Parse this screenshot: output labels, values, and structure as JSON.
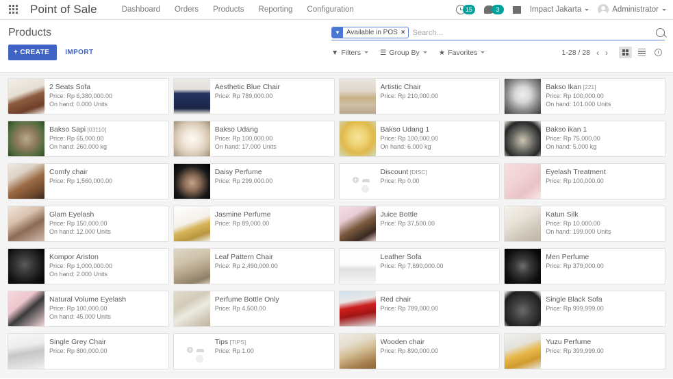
{
  "navbar": {
    "apps_icon": "apps-grid-icon",
    "brand": "Point of Sale",
    "menu": [
      {
        "label": "Dashboard"
      },
      {
        "label": "Orders"
      },
      {
        "label": "Products"
      },
      {
        "label": "Reporting"
      },
      {
        "label": "Configuration"
      }
    ],
    "activity_icon": "clock-icon",
    "activity_count": "15",
    "messages_icon": "chat-bubble-icon",
    "messages_count": "3",
    "gift_icon": "gift-icon",
    "company": "Impact Jakarta",
    "user": "Administrator",
    "badge_color": "#00a09d"
  },
  "control_panel": {
    "title": "Products",
    "create_label": "+ CREATE",
    "import_label": "IMPORT",
    "accent_color": "#3f64c4",
    "search": {
      "facet_icon": "filter-funnel-icon",
      "facet_label": "Available in POS",
      "facet_remove": "×",
      "placeholder": "Search...",
      "value": "",
      "search_icon": "search-icon"
    },
    "tools": [
      {
        "icon": "filter-icon",
        "label": "Filters"
      },
      {
        "icon": "group-by-icon",
        "label": "Group By"
      },
      {
        "icon": "star-icon",
        "label": "Favorites"
      }
    ],
    "pager": {
      "range": "1-28 / 28",
      "prev_icon": "chevron-left-icon",
      "next_icon": "chevron-right-icon"
    },
    "views": [
      {
        "name": "kanban-view",
        "icon": "kanban-icon",
        "active": true
      },
      {
        "name": "list-view",
        "icon": "list-icon",
        "active": false
      },
      {
        "name": "activity-view",
        "icon": "clock-icon",
        "active": false
      }
    ]
  },
  "products": [
    {
      "name": "2 Seats Sofa",
      "code": "",
      "price": "Price: Rp 6,380,000.00",
      "onhand": "On hand: 0.000 Units",
      "img": "sofa-brown",
      "placeholder": false
    },
    {
      "name": "Aesthetic Blue Chair",
      "code": "",
      "price": "Price: Rp 789,000.00",
      "onhand": "",
      "img": "chair-blue",
      "placeholder": false
    },
    {
      "name": "Artistic Chair",
      "code": "",
      "price": "Price: Rp 210,000.00",
      "onhand": "",
      "img": "chair-wood",
      "placeholder": false
    },
    {
      "name": "Bakso Ikan",
      "code": "[221]",
      "price": "Price: Rp 100,000.00",
      "onhand": "On hand: 101.000 Units",
      "img": "bakso-ikan",
      "placeholder": false
    },
    {
      "name": "Bakso Sapi",
      "code": "[03110]",
      "price": "Price: Rp 65,000.00",
      "onhand": "On hand: 260.000 kg",
      "img": "bakso-sapi",
      "placeholder": false
    },
    {
      "name": "Bakso Udang",
      "code": "",
      "price": "Price: Rp 100,000.00",
      "onhand": "On hand: 17.000 Units",
      "img": "bakso-udang",
      "placeholder": false
    },
    {
      "name": "Bakso Udang 1",
      "code": "",
      "price": "Price: Rp 100,000.00",
      "onhand": "On hand: 6.000 kg",
      "img": "bakso-udang-1",
      "placeholder": false
    },
    {
      "name": "Bakso ikan 1",
      "code": "",
      "price": "Price: Rp 75,000.00",
      "onhand": "On hand: 5.000 kg",
      "img": "bakso-ikan-1",
      "placeholder": false
    },
    {
      "name": "Comfy chair",
      "code": "",
      "price": "Price: Rp 1,560,000.00",
      "onhand": "",
      "img": "comfy-chair",
      "placeholder": false
    },
    {
      "name": "Daisy Perfume",
      "code": "",
      "price": "Price: Rp 299,000.00",
      "onhand": "",
      "img": "daisy-perfume",
      "placeholder": false
    },
    {
      "name": "Discount",
      "code": "[DISC]",
      "price": "Price: Rp 0.00",
      "onhand": "",
      "img": "",
      "placeholder": true
    },
    {
      "name": "Eyelash Treatment",
      "code": "",
      "price": "Price: Rp 100,000.00",
      "onhand": "",
      "img": "eyelash-treatment",
      "placeholder": false
    },
    {
      "name": "Glam Eyelash",
      "code": "",
      "price": "Price: Rp 150,000.00",
      "onhand": "On hand: 12.000 Units",
      "img": "glam-eyelash",
      "placeholder": false
    },
    {
      "name": "Jasmine Perfume",
      "code": "",
      "price": "Price: Rp 89,000.00",
      "onhand": "",
      "img": "jasmine-perfume",
      "placeholder": false
    },
    {
      "name": "Juice Bottle",
      "code": "",
      "price": "Price: Rp 37,500.00",
      "onhand": "",
      "img": "juice-bottle",
      "placeholder": false
    },
    {
      "name": "Katun Silk",
      "code": "",
      "price": "Price: Rp 10,000.00",
      "onhand": "On hand: 199.000 Units",
      "img": "katun-silk",
      "placeholder": false
    },
    {
      "name": "Kompor Ariston",
      "code": "",
      "price": "Price: Rp 1,000,000.00",
      "onhand": "On hand: 2.000 Units",
      "img": "kompor-ariston",
      "placeholder": false
    },
    {
      "name": "Leaf Pattern Chair",
      "code": "",
      "price": "Price: Rp 2,490,000.00",
      "onhand": "",
      "img": "leaf-pattern-chair",
      "placeholder": false
    },
    {
      "name": "Leather Sofa",
      "code": "",
      "price": "Price: Rp 7,690,000.00",
      "onhand": "",
      "img": "leather-sofa",
      "placeholder": false
    },
    {
      "name": "Men Perfume",
      "code": "",
      "price": "Price: Rp 379,000.00",
      "onhand": "",
      "img": "men-perfume",
      "placeholder": false
    },
    {
      "name": "Natural Volume Eyelash",
      "code": "",
      "price": "Price: Rp 100,000.00",
      "onhand": "On hand: 45.000 Units",
      "img": "natural-volume-eyelash",
      "placeholder": false
    },
    {
      "name": "Perfume Bottle Only",
      "code": "",
      "price": "Price: Rp 4,500.00",
      "onhand": "",
      "img": "perfume-bottle-only",
      "placeholder": false
    },
    {
      "name": "Red chair",
      "code": "",
      "price": "Price: Rp 789,000.00",
      "onhand": "",
      "img": "red-chair",
      "placeholder": false
    },
    {
      "name": "Single Black Sofa",
      "code": "",
      "price": "Price: Rp 999,999.00",
      "onhand": "",
      "img": "single-black-sofa",
      "placeholder": false
    },
    {
      "name": "Single Grey Chair",
      "code": "",
      "price": "Price: Rp 800,000.00",
      "onhand": "",
      "img": "single-grey-chair",
      "placeholder": false
    },
    {
      "name": "Tips",
      "code": "[TIPS]",
      "price": "Price: Rp 1.00",
      "onhand": "",
      "img": "",
      "placeholder": true
    },
    {
      "name": "Wooden chair",
      "code": "",
      "price": "Price: Rp 890,000.00",
      "onhand": "",
      "img": "wooden-chair",
      "placeholder": false
    },
    {
      "name": "Yuzu Perfume",
      "code": "",
      "price": "Price: Rp 399,999.00",
      "onhand": "",
      "img": "yuzu-perfume",
      "placeholder": false
    }
  ],
  "product_image_colors": {
    "sofa-brown": "linear-gradient(160deg,#f2efe9 0%,#e6ded3 40%,#8d5b3f 55%,#6f402a 80%,#efe9e0 100%)",
    "chair-blue": "linear-gradient(180deg,#eceae6 0%,#e3e0da 30%,#24335e 42%,#1b2647 85%,#dedbd5 100%)",
    "chair-wood": "linear-gradient(180deg,#e9e6e0 0%,#ddd6c9 35%,#c9b189 55%,#cfc0a5 75%,#b8a68d 100%)",
    "bakso-ikan": "radial-gradient(circle at 50% 45%,#efefef 0%,#d6d6d6 30%,#8e8e8e 60%,#3c3c3c 100%)",
    "bakso-sapi": "radial-gradient(circle at 50% 50%,#b9a98d 0%,#8d7a5c 40%,#4e6b3c 75%,#2f4326 100%)",
    "bakso-udang": "radial-gradient(circle at 50% 50%,#fdfbf6 0%,#f0e6d8 35%,#d8c9b4 65%,#9e8f7b 100%)",
    "bakso-udang-1": "radial-gradient(circle at 50% 45%,#f6e39a 0%,#edd070 35%,#e0b94b 60%,#cfd9c0 100%)",
    "bakso-ikan-1": "radial-gradient(circle at 50% 55%,#cfc6b6 0%,#6a6a64 40%,#262626 72%,#e8e4dc 100%)",
    "comfy-chair": "linear-gradient(150deg,#efe9e2 0%,#ddd2c4 30%,#9c6a44 55%,#6f4a2e 80%,#3a2a1e 100%)",
    "daisy-perfume": "radial-gradient(circle at 50% 55%,#c8a48a 0%,#8a6b55 30%,#1a1a1a 65%,#000 100%)",
    "eyelash-treatment": "linear-gradient(140deg,#f6dede 0%,#f2d2d4 40%,#e9c2c6 70%,#f8e8e8 100%)",
    "glam-eyelash": "linear-gradient(150deg,#efe6dd 0%,#d8c0ad 35%,#8d6a54 60%,#cfbcae 100%)",
    "jasmine-perfume": "linear-gradient(160deg,#ffffff 0%,#f4f1ea 45%,#d8b55c 60%,#b89640 80%,#f2efe8 100%)",
    "juice-bottle": "linear-gradient(150deg,#f3dfe4 0%,#e9cdd6 30%,#7a5a3e 55%,#3a2a20 80%,#e6d2cf 100%)",
    "katun-silk": "linear-gradient(150deg,#f5f2ec 0%,#e7e1d6 40%,#cfc7ba 70%,#bdb4a6 100%)",
    "kompor-ariston": "radial-gradient(circle at 45% 45%,#5a5a5a 0%,#333 35%,#111 70%,#000 100%)",
    "leaf-pattern-chair": "linear-gradient(160deg,#ded6c6 0%,#cfc3ab 35%,#b3a489 60%,#8d7f66 85%,#d6cdbc 100%)",
    "leather-sofa": "linear-gradient(180deg,#ffffff 0%,#fdfdfd 45%,#e0e0e0 58%,#f5f5f5 100%)",
    "men-perfume": "radial-gradient(circle at 50% 50%,#6e6e6e 0%,#3a3a3a 30%,#101010 70%,#000 100%)",
    "natural-volume-eyelash": "linear-gradient(140deg,#f6d9dd 0%,#eec6cd 35%,#3a3a3a 55%,#f2d6da 100%)",
    "perfume-bottle-only": "linear-gradient(150deg,#e2dccf 0%,#d4cbb9 35%,#eceae2 55%,#cdc4b1 85%,#bdb3a0 100%)",
    "red-chair": "linear-gradient(170deg,#cfe0ec 0%,#e8e8e8 28%,#cc1f1f 45%,#a31515 65%,#dcdcdc 100%)",
    "single-black-sofa": "radial-gradient(circle at 50% 55%,#6a6a6a 0%,#3c3c3c 40%,#1e1e1e 75%,#ffffff 100%)",
    "single-grey-chair": "linear-gradient(170deg,#f7f7f7 0%,#ededed 35%,#c6c6c6 55%,#efefef 100%)",
    "wooden-chair": "linear-gradient(160deg,#f0ece4 0%,#e4dccb 30%,#d4bf96 50%,#a8804f 80%,#8a6438 100%)",
    "yuzu-perfume": "linear-gradient(160deg,#efefef 0%,#e4e2da 35%,#e8b84a 55%,#cf9b2e 75%,#e8e6de 100%)"
  }
}
